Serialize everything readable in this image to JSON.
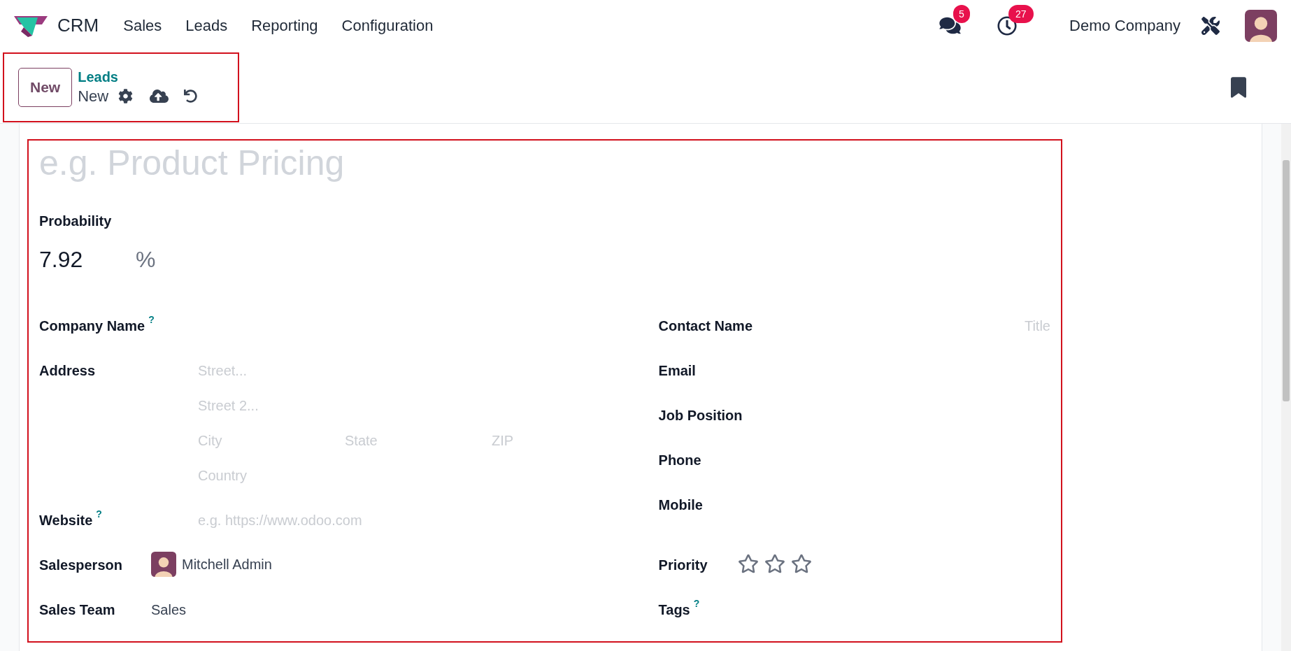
{
  "navbar": {
    "app_name": "CRM",
    "menu": [
      "Sales",
      "Leads",
      "Reporting",
      "Configuration"
    ],
    "messages_badge": "5",
    "activities_badge": "27",
    "company": "Demo Company"
  },
  "control_panel": {
    "new_button": "New",
    "breadcrumb": "Leads",
    "record": "New"
  },
  "form": {
    "title_placeholder": "e.g. Product Pricing",
    "probability": {
      "label": "Probability",
      "value": "7.92",
      "unit": "%"
    },
    "left_fields": [
      {
        "kind": "text",
        "label": "Company Name",
        "help": "?"
      },
      {
        "kind": "address",
        "label": "Address",
        "lines": [
          [
            {
              "placeholder": "Street..."
            }
          ],
          [
            {
              "placeholder": "Street 2..."
            }
          ],
          [
            {
              "placeholder": "City"
            },
            {
              "placeholder": "State"
            },
            {
              "placeholder": "ZIP"
            }
          ],
          [
            {
              "placeholder": "Country"
            }
          ]
        ]
      },
      {
        "kind": "text",
        "label": "Website",
        "help": "?",
        "placeholder": "e.g. https://www.odoo.com"
      },
      {
        "kind": "user",
        "label": "Salesperson",
        "value": "Mitchell Admin"
      },
      {
        "kind": "text",
        "label": "Sales Team",
        "value": "Sales"
      }
    ],
    "right_fields": [
      {
        "kind": "text",
        "label": "Contact Name",
        "placeholder": "Title"
      },
      {
        "kind": "text",
        "label": "Email"
      },
      {
        "kind": "text",
        "label": "Job Position"
      },
      {
        "kind": "text",
        "label": "Phone"
      },
      {
        "kind": "text",
        "label": "Mobile"
      },
      {
        "kind": "priority",
        "label": "Priority",
        "stars": 0
      },
      {
        "kind": "text",
        "label": "Tags",
        "help": "?"
      }
    ]
  }
}
